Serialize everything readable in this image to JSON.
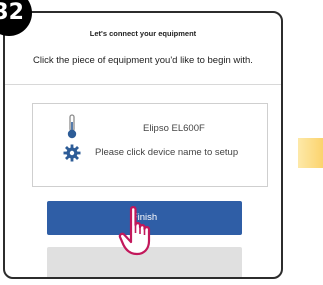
{
  "step": {
    "number": "32"
  },
  "screen": {
    "title": "Let's connect your equipment",
    "instruction": "Click the piece of equipment you'd like to begin with."
  },
  "device": {
    "name": "Elipso EL600F",
    "hint": "Please click device name to setup",
    "icons": [
      "thermometer-icon",
      "gear-icon"
    ]
  },
  "buttons": {
    "finish_label": "Finish",
    "secondary_label": ""
  },
  "colors": {
    "accent": "#2f5ea6",
    "secondary_button": "#e0e0e0",
    "side_tab": "#fbd36d",
    "icon": "#2d5c97"
  }
}
